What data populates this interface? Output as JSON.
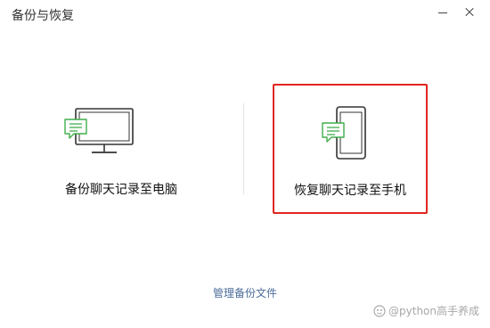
{
  "window": {
    "title": "备份与恢复"
  },
  "options": {
    "backup_to_pc": {
      "label": "备份聊天记录至电脑",
      "icon": "monitor-chat-icon"
    },
    "restore_to_phone": {
      "label": "恢复聊天记录至手机",
      "icon": "phone-chat-icon",
      "highlighted": true
    }
  },
  "footer": {
    "manage_link": "管理备份文件"
  },
  "watermark": {
    "text": "@python高手养成"
  },
  "colors": {
    "highlight_border": "#e0261f",
    "chat_green": "#3fad4a",
    "link_blue": "#4c6d9a",
    "icon_stroke": "#333333"
  }
}
